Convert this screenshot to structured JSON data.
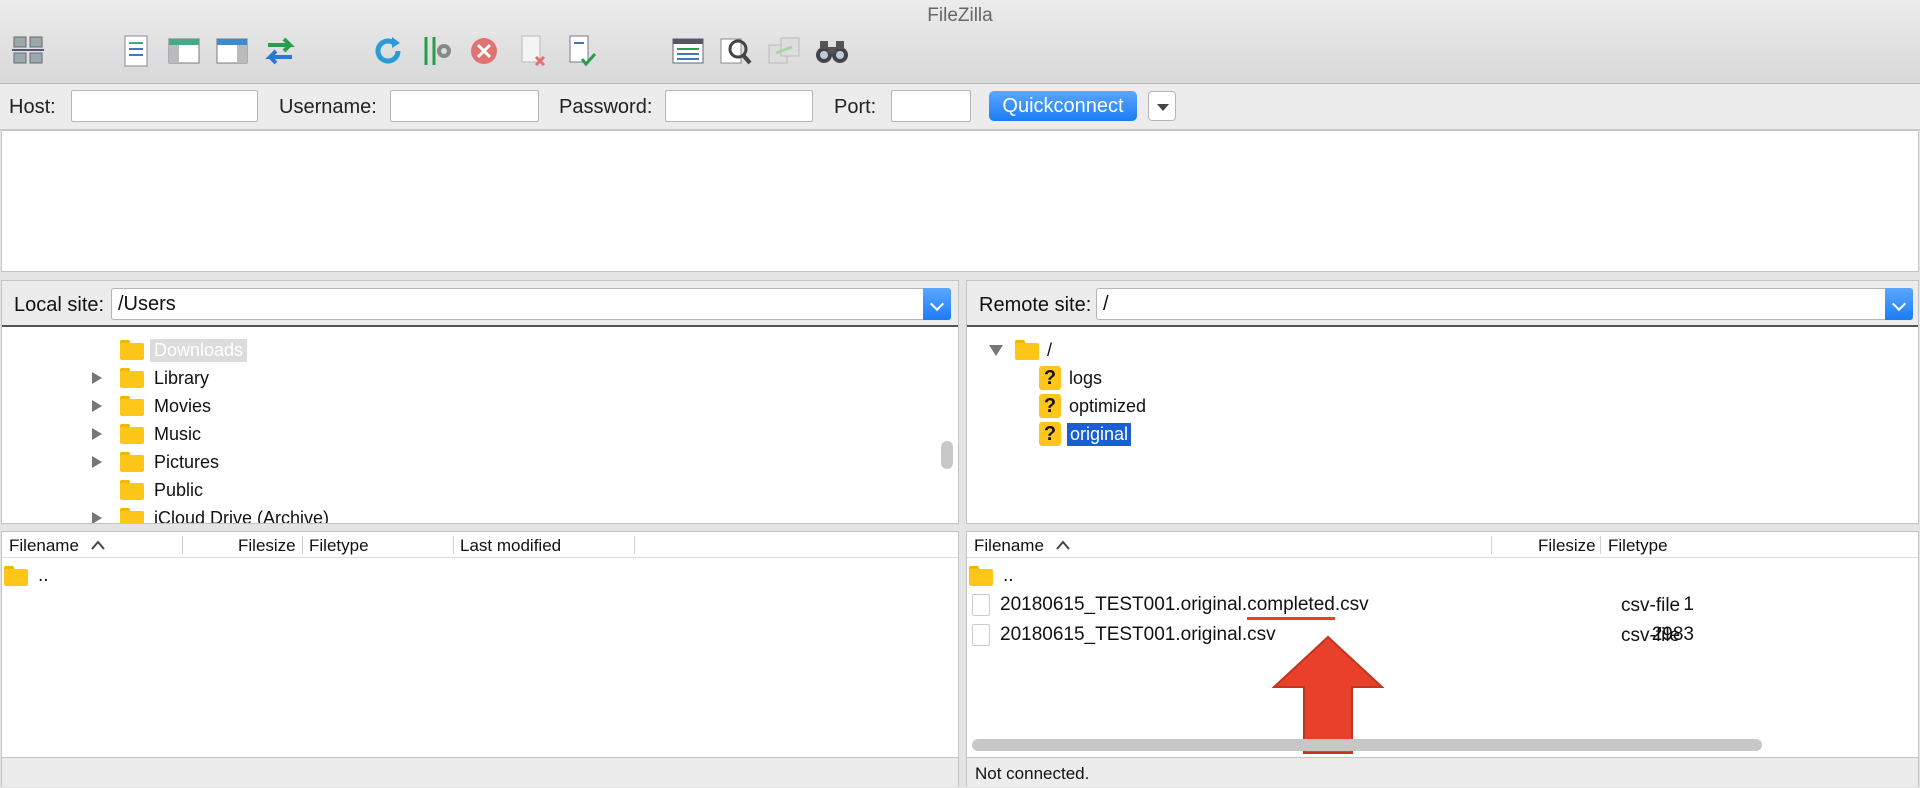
{
  "app": {
    "title": "FileZilla"
  },
  "quickconnect": {
    "host_label": "Host:",
    "username_label": "Username:",
    "password_label": "Password:",
    "port_label": "Port:",
    "host_value": "",
    "username_value": "",
    "password_value": "",
    "port_value": "",
    "button_label": "Quickconnect"
  },
  "local": {
    "site_label": "Local site:",
    "path": "/Users",
    "tree": [
      {
        "label": "Downloads",
        "expandable": false
      },
      {
        "label": "Library",
        "expandable": true
      },
      {
        "label": "Movies",
        "expandable": true
      },
      {
        "label": "Music",
        "expandable": true
      },
      {
        "label": "Pictures",
        "expandable": true
      },
      {
        "label": "Public",
        "expandable": false
      },
      {
        "label": "iCloud Drive (Archive)",
        "expandable": true
      }
    ],
    "columns": {
      "filename": "Filename",
      "filesize": "Filesize",
      "filetype": "Filetype",
      "modified": "Last modified"
    },
    "files": [
      {
        "name": ".."
      }
    ],
    "status": ""
  },
  "remote": {
    "site_label": "Remote site:",
    "path": "/",
    "tree": [
      {
        "label": "/",
        "icon": "folder"
      },
      {
        "label": "logs",
        "icon": "question"
      },
      {
        "label": "optimized",
        "icon": "question"
      },
      {
        "label": "original",
        "icon": "question",
        "selected": true
      }
    ],
    "columns": {
      "filename": "Filename",
      "filesize": "Filesize",
      "filetype": "Filetype"
    },
    "files": [
      {
        "name": "..",
        "size": "",
        "type": ""
      },
      {
        "name_prefix": "20180615_TEST001.original.",
        "name_highlight": "completed",
        "name_suffix": ".csv",
        "size": "1",
        "type": "csv-file"
      },
      {
        "name": "20180615_TEST001.original.csv",
        "size": "2983",
        "type": "csv-file"
      }
    ],
    "status": "Not connected."
  },
  "colors": {
    "accent": "#1c7cf4",
    "selection": "#1a5fd1",
    "annotation_red": "#e8402a",
    "folder": "#ffc61a"
  }
}
